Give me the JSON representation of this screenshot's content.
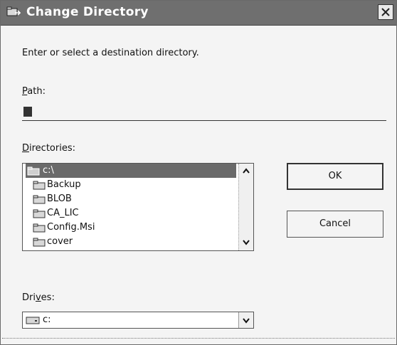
{
  "window": {
    "title": "Change Directory"
  },
  "instruction": "Enter or select a destination directory.",
  "path": {
    "label_accel": "P",
    "label_rest": "ath:",
    "value": ""
  },
  "directories": {
    "label_accel": "D",
    "label_rest": "irectories:",
    "items": [
      {
        "name": "c:\\",
        "selected": true
      },
      {
        "name": "Backup",
        "selected": false
      },
      {
        "name": "BLOB",
        "selected": false
      },
      {
        "name": "CA_LIC",
        "selected": false
      },
      {
        "name": "Config.Msi",
        "selected": false
      },
      {
        "name": "cover",
        "selected": false
      }
    ]
  },
  "buttons": {
    "ok": "OK",
    "cancel": "Cancel"
  },
  "drives": {
    "label_accel": "v",
    "label_pre": "Dri",
    "label_rest": "es:",
    "selected": "c:"
  },
  "icons": {
    "title": "directory-icon",
    "folder": "folder-icon",
    "drive": "drive-icon",
    "close": "close-icon"
  }
}
